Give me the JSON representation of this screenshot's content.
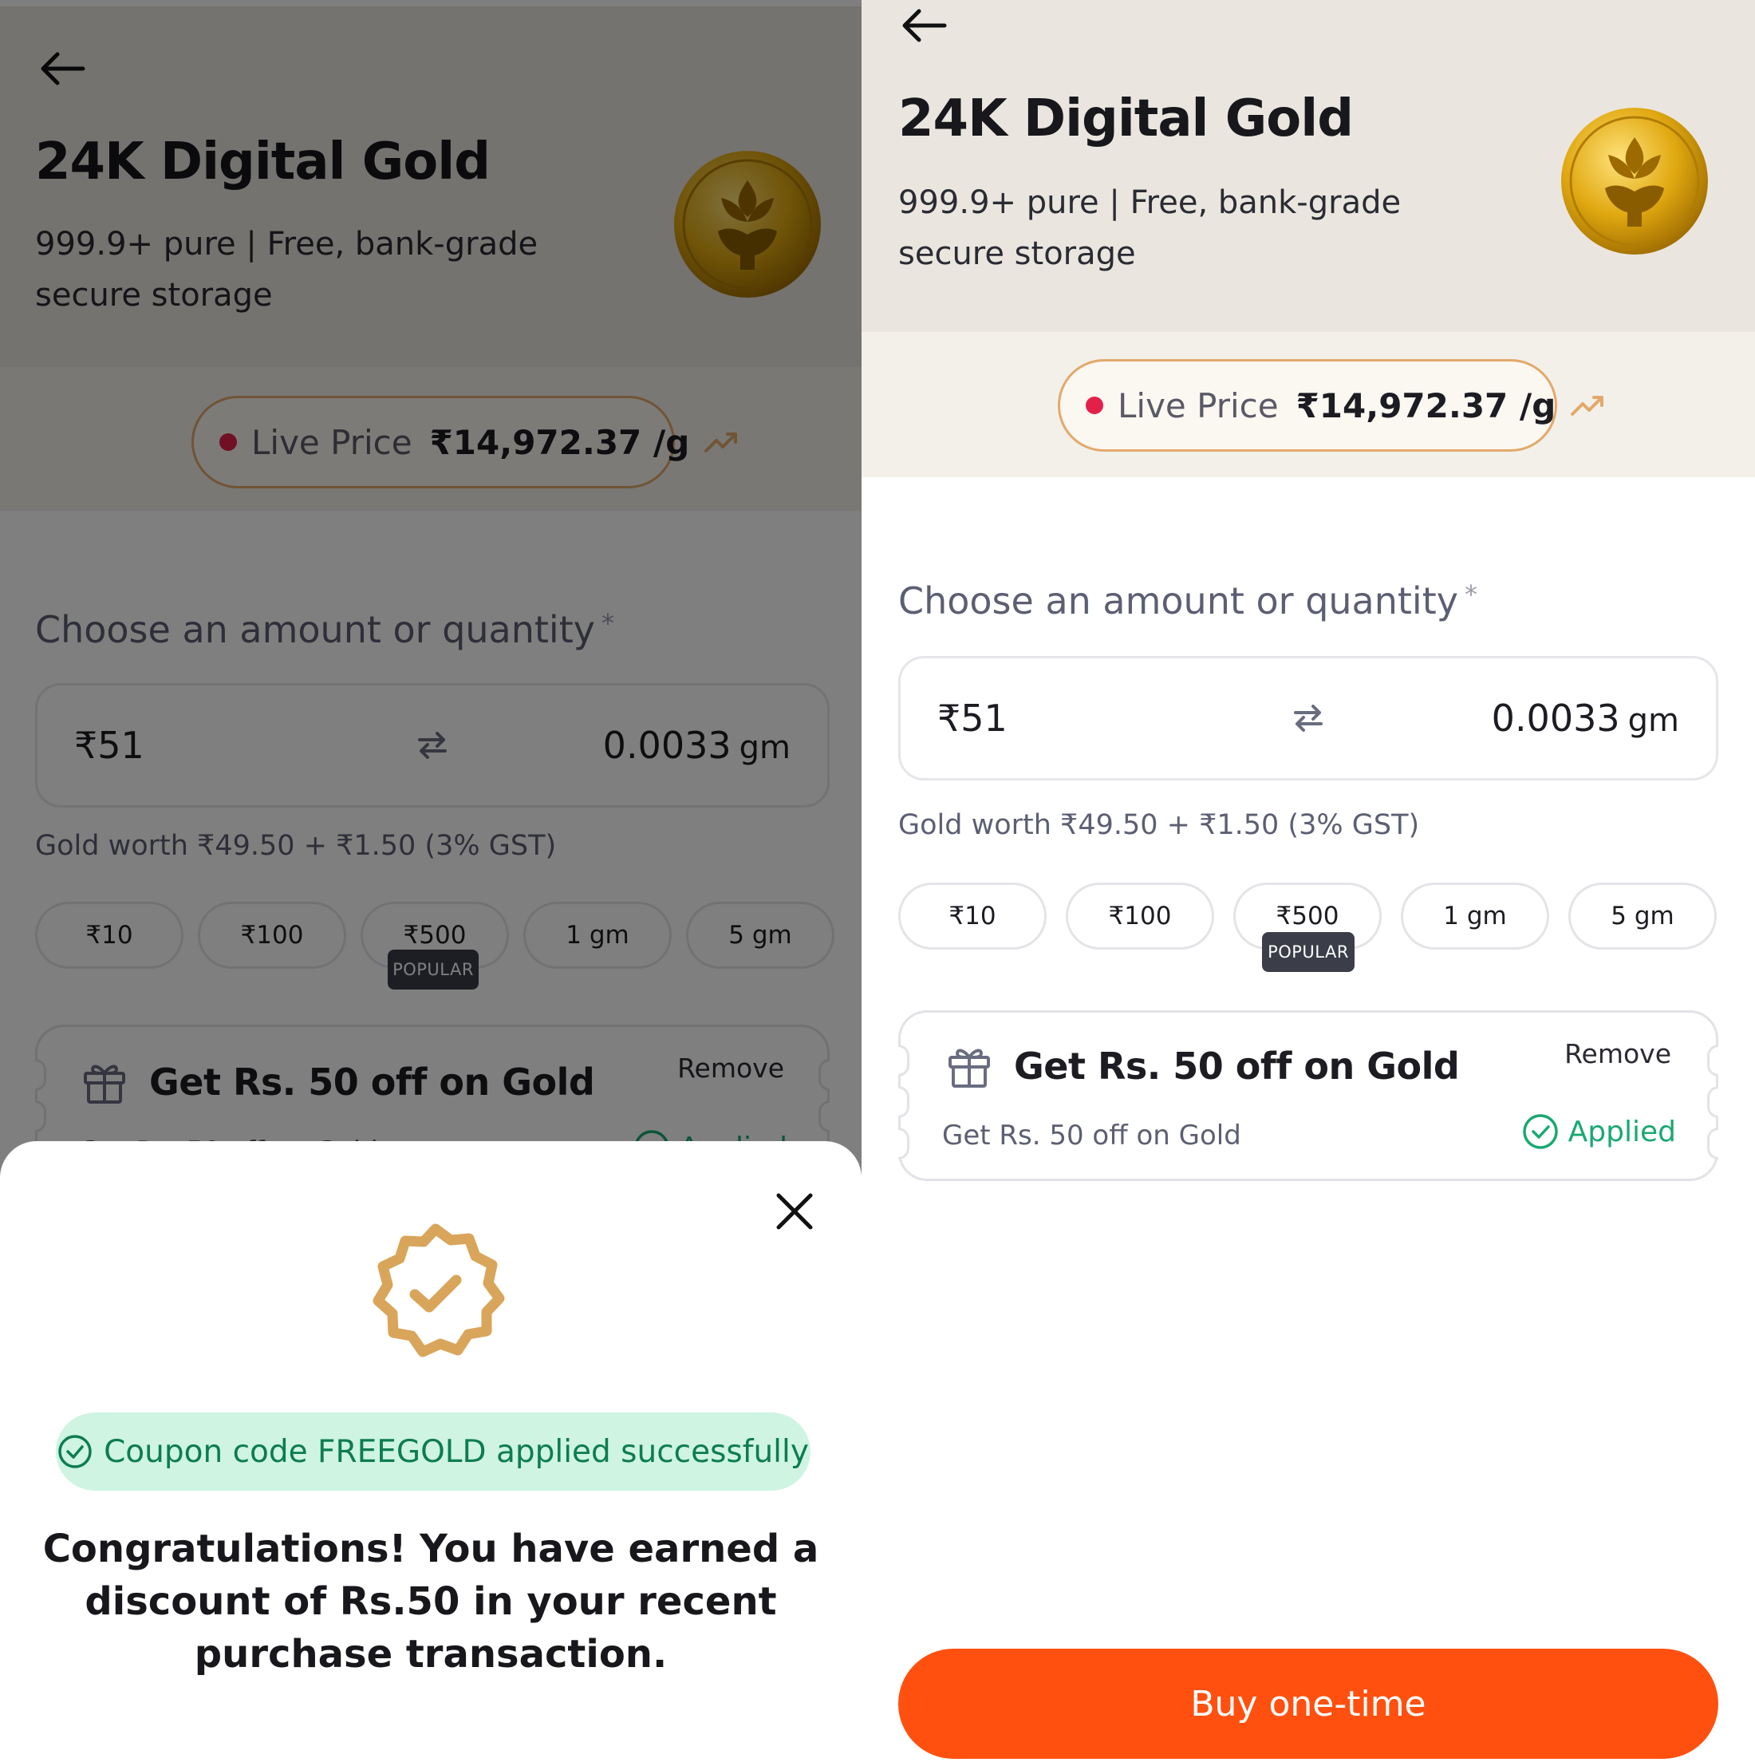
{
  "product": {
    "title": "24K Digital Gold",
    "subtitle": "999.9+ pure | Free, bank-grade secure storage"
  },
  "live_price": {
    "label": "Live Price",
    "value": "₹14,972.37 /g",
    "trend_icon": "trend-up-icon"
  },
  "amount": {
    "label": "Choose an amount or quantity",
    "required_mark": "*",
    "rupees": "₹51",
    "grams": "0.0033",
    "grams_unit": "gm",
    "gst_note": "Gold worth ₹49.50 + ₹1.50 (3% GST)"
  },
  "chips": [
    {
      "label": "₹10"
    },
    {
      "label": "₹100"
    },
    {
      "label": "₹500",
      "badge": "POPULAR"
    },
    {
      "label": "1 gm"
    },
    {
      "label": "5 gm"
    }
  ],
  "coupon": {
    "title": "Get Rs. 50 off on Gold",
    "subtitle": "Get Rs. 50 off on Gold",
    "remove": "Remove",
    "status": "Applied"
  },
  "sheet": {
    "toast": "Coupon code FREEGOLD applied successfully",
    "message": "Congratulations! You have earned a discount of Rs.50 in your recent purchase transaction."
  },
  "cta": {
    "label": "Buy one-time"
  },
  "colors": {
    "accent": "#ff5010",
    "success": "#1aa872",
    "live_dot": "#e2204a",
    "seal": "#d9a55a"
  }
}
